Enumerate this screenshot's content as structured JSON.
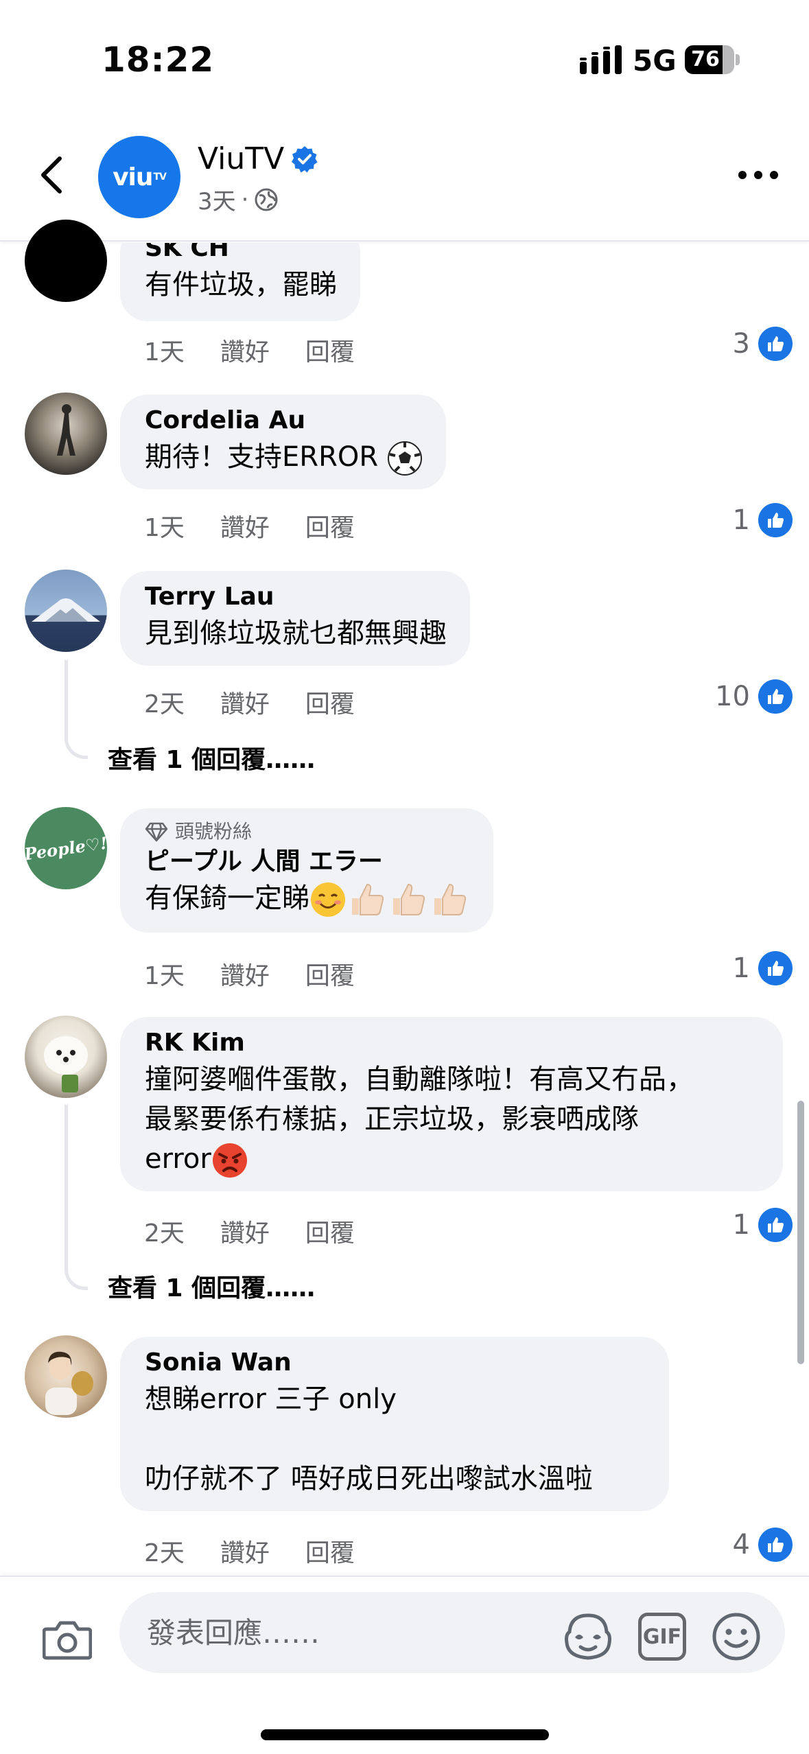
{
  "status_bar": {
    "time": "18:22",
    "network": "5G",
    "battery": "76",
    "battery_level": 0.76
  },
  "header": {
    "page_name": "ViuTV",
    "avatar_text": "viu",
    "avatar_superscript": "TV",
    "post_age": "3天",
    "separator": "·"
  },
  "comments": [
    {
      "name": "SK CH",
      "text": "有件垃圾，罷睇",
      "time": "1天",
      "like_label": "讚好",
      "reply_label": "回覆",
      "likes": "3"
    },
    {
      "name": "Cordelia Au",
      "text": "期待！支持ERROR",
      "emoji": "soccer-ball",
      "time": "1天",
      "like_label": "讚好",
      "reply_label": "回覆",
      "likes": "1"
    },
    {
      "name": "Terry Lau",
      "text": "見到條垃圾就乜都無興趣",
      "time": "2天",
      "like_label": "讚好",
      "reply_label": "回覆",
      "likes": "10",
      "view_replies": "查看 1 個回覆……"
    },
    {
      "badge": "頭號粉絲",
      "name": "ピープル 人間 エラー",
      "text": "有保錡一定睇",
      "emojis": [
        "smiling-face",
        "thumbs-up",
        "thumbs-up",
        "thumbs-up"
      ],
      "time": "1天",
      "like_label": "讚好",
      "reply_label": "回覆",
      "likes": "1",
      "avatar_text": "People♡!"
    },
    {
      "name": "RK Kim",
      "text_line1": "撞阿婆嗰件蛋散，自動離隊啦！有高又冇品，",
      "text_line2": "最緊要係冇樣掂，正宗垃圾，影衰哂成隊",
      "text_line3": "error",
      "emoji": "angry-face",
      "time": "2天",
      "like_label": "讚好",
      "reply_label": "回覆",
      "likes": "1",
      "view_replies": "查看 1 個回覆……"
    },
    {
      "name": "Sonia Wan",
      "text_line1": "想睇error 三子 only",
      "text_line2": "",
      "text_line3": "叻仔就不了 唔好成日死出嚟試水溫啦",
      "time": "2天",
      "like_label": "讚好",
      "reply_label": "回覆",
      "likes": "4"
    }
  ],
  "composer": {
    "placeholder": "發表回應……",
    "gif_label": "GIF"
  },
  "colors": {
    "brand_blue": "#1577e9",
    "like_blue": "#1b74e4",
    "bubble_bg": "#f0f2f5",
    "secondary_text": "#65676b"
  }
}
